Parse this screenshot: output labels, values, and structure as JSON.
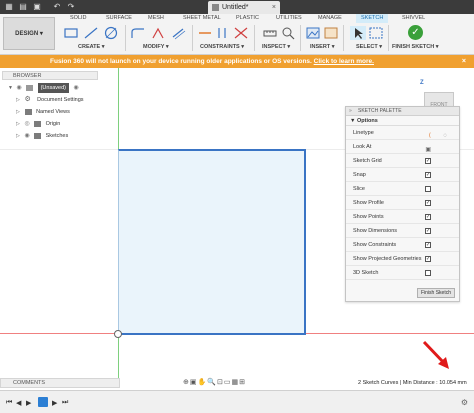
{
  "doc": {
    "title": "Untitled*",
    "close": "×"
  },
  "design": {
    "label": "DESIGN ▾"
  },
  "tabs": [
    "SOLID",
    "SURFACE",
    "MESH",
    "SHEET METAL",
    "PLASTIC",
    "UTILITIES",
    "MANAGE",
    "SKETCH",
    "SHIVVEL"
  ],
  "groups": [
    "CREATE ▾",
    "MODIFY ▾",
    "CONSTRAINTS ▾",
    "INSPECT ▾",
    "INSERT ▾",
    "SELECT ▾",
    "FINISH SKETCH ▾"
  ],
  "banner": {
    "text": "Fusion 360 will not launch on your device running older applications or OS versions. ",
    "link": "Click to learn more.",
    "close": "×"
  },
  "browser": {
    "title": "BROWSER",
    "items": [
      "(Unsaved)",
      "Document Settings",
      "Named Views",
      "Origin",
      "Sketches"
    ]
  },
  "viewcube": {
    "face": "FRONT",
    "axis": "Z"
  },
  "palette": {
    "title": "SKETCH PALETTE",
    "options_label": "Options",
    "rows": [
      {
        "label": "Linetype",
        "kind": "icons"
      },
      {
        "label": "Look At",
        "kind": "icon"
      },
      {
        "label": "Sketch Grid",
        "kind": "check",
        "checked": true
      },
      {
        "label": "Snap",
        "kind": "check",
        "checked": true
      },
      {
        "label": "Slice",
        "kind": "check",
        "checked": false
      },
      {
        "label": "Show Profile",
        "kind": "check",
        "checked": true
      },
      {
        "label": "Show Points",
        "kind": "check",
        "checked": true
      },
      {
        "label": "Show Dimensions",
        "kind": "check",
        "checked": true
      },
      {
        "label": "Show Constraints",
        "kind": "check",
        "checked": true
      },
      {
        "label": "Show Projected Geometries",
        "kind": "check",
        "checked": true
      },
      {
        "label": "3D Sketch",
        "kind": "check",
        "checked": false
      }
    ],
    "finish_button": "Finish Sketch"
  },
  "comments": {
    "label": "COMMENTS"
  },
  "status": {
    "text": "2 Sketch Curves | Min Distance : 10.054 mm"
  },
  "colors": {
    "banner": "#f0a030",
    "sketch_line": "#3a74c4",
    "accent": "#1b6fb0"
  }
}
